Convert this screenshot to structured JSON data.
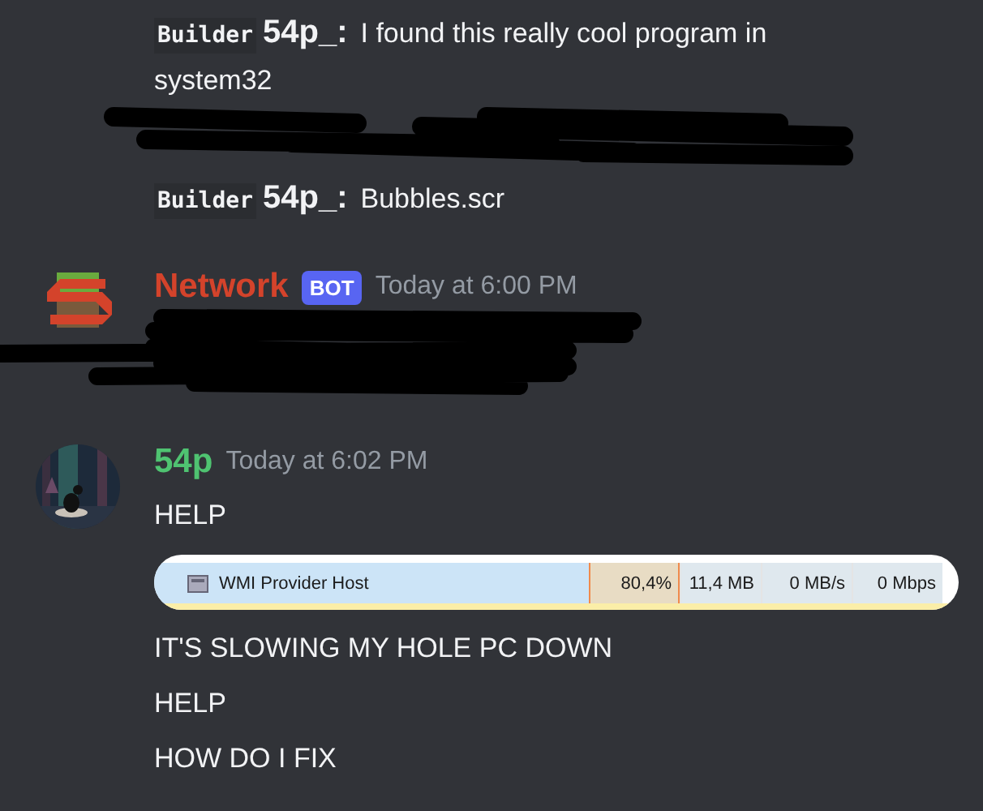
{
  "groups": [
    {
      "lines": [
        {
          "kind": "quote",
          "prefix": "Builder",
          "author": "54p_:",
          "text": "I found this really cool program in system32"
        },
        {
          "kind": "redacted"
        },
        {
          "kind": "quote",
          "prefix": "Builder",
          "author": "54p_:",
          "text": "Bubbles.scr"
        }
      ]
    },
    {
      "author": "Network",
      "color": "#d4432b",
      "avatar": {
        "kind": "bot"
      },
      "tag": "BOT",
      "time": "Today at 6:00 PM",
      "lines": [
        {
          "kind": "redacted_double"
        }
      ]
    },
    {
      "author": "54p",
      "color": "#4fc371",
      "time": "Today at 6:02 PM",
      "lines": [
        {
          "kind": "plain",
          "text": "HELP"
        },
        {
          "kind": "embed",
          "process": "WMI Provider Host",
          "cells": [
            "80,4%",
            "11,4 MB",
            "0 MB/s",
            "0 Mbps"
          ]
        },
        {
          "kind": "plain",
          "text": "IT'S SLOWING MY HOLE PC DOWN"
        },
        {
          "kind": "plain",
          "text": "HELP"
        },
        {
          "kind": "plain",
          "text": "HOW DO I FIX"
        }
      ]
    }
  ]
}
